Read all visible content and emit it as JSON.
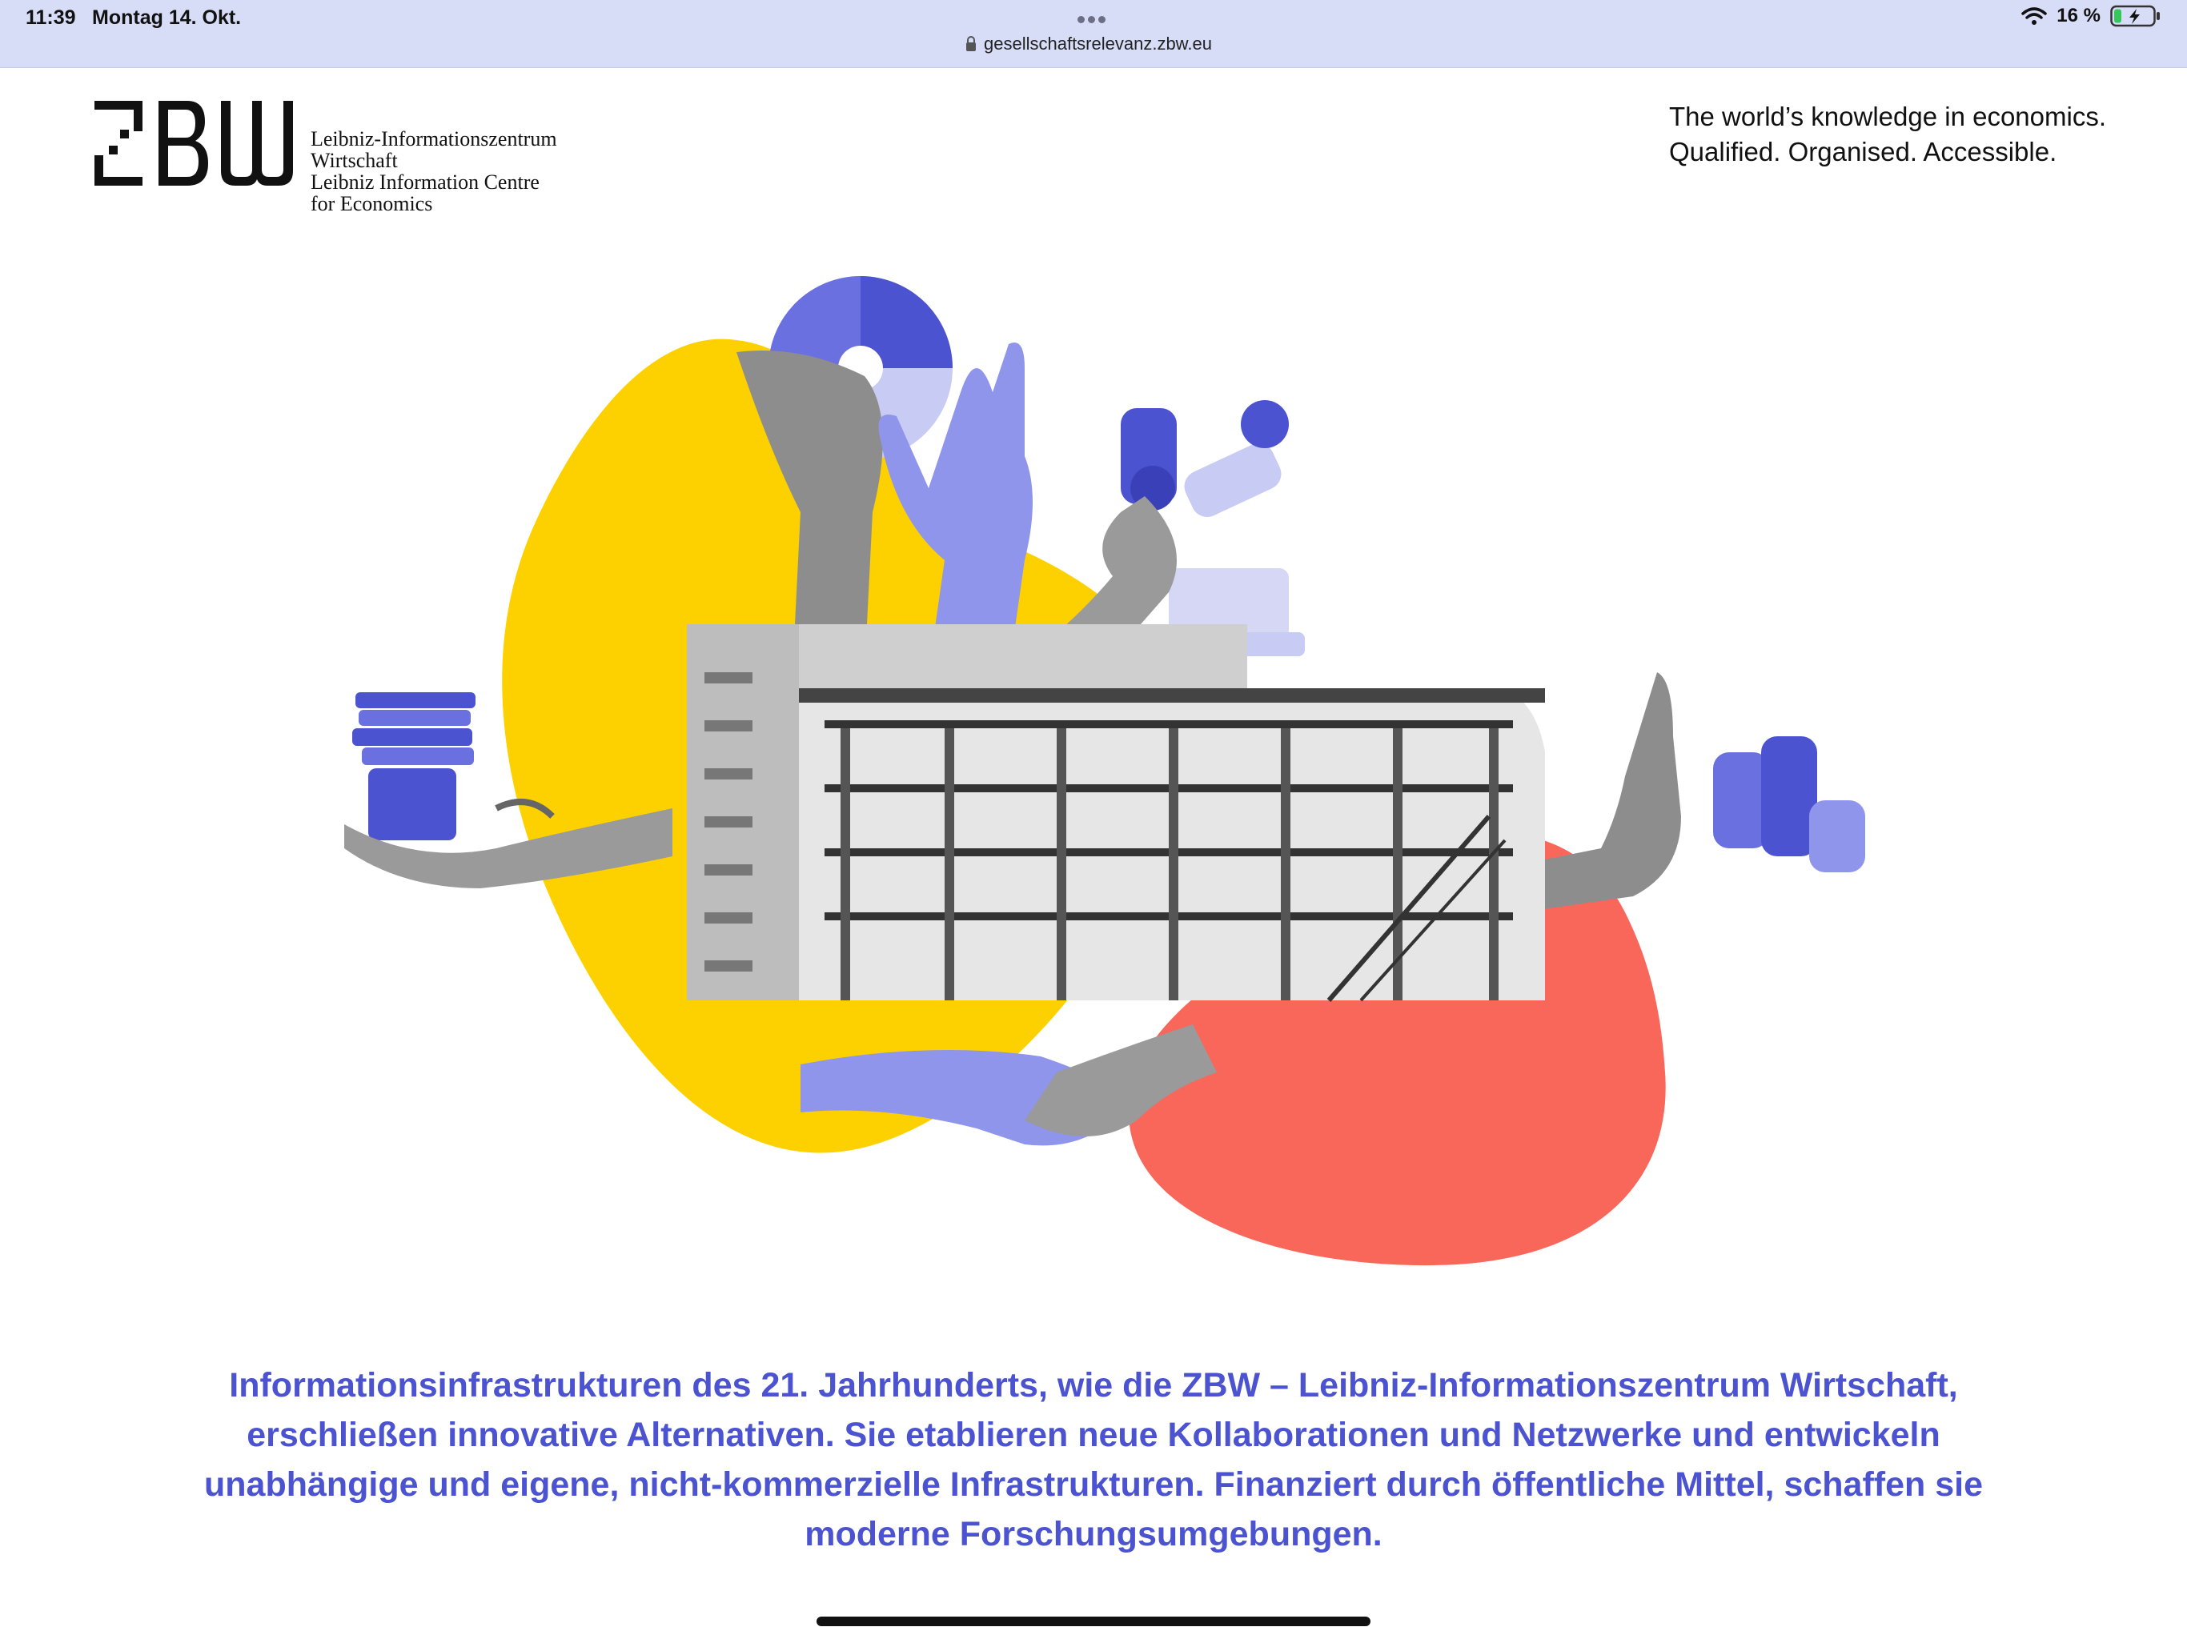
{
  "status_bar": {
    "time": "11:39",
    "date": "Montag 14. Okt.",
    "url": "gesellschaftsrelevanz.zbw.eu",
    "battery": "16 %"
  },
  "header": {
    "logo_lines": [
      "Leibniz-Informationszentrum",
      "Wirtschaft",
      "Leibniz Information Centre",
      "for Economics"
    ],
    "tagline_lines": [
      "The world’s knowledge in economics.",
      "Qualified. Organised. Accessible."
    ]
  },
  "main": {
    "intro_text": "Informationsinfrastrukturen des 21. Jahrhunderts, wie die ZBW – Leibniz-Informationszentrum Wirtschaft, erschließen innovative Alternativen. Sie etablieren neue Kollaborationen und Netzwerke und entwickeln unabhängige und eigene, nicht-kommerzielle Infrastrukturen. Finanziert durch öffentliche Mittel, schaffen sie moderne Forschungsumgebungen."
  },
  "colors": {
    "accent_blue": "#4b53d1",
    "blob_yellow": "#fdd000",
    "blob_red": "#f9675b",
    "statusbar_bg": "#d7dcf7"
  },
  "icons": [
    "lock-icon",
    "wifi-icon",
    "battery-icon",
    "zbw-logo-mark"
  ]
}
